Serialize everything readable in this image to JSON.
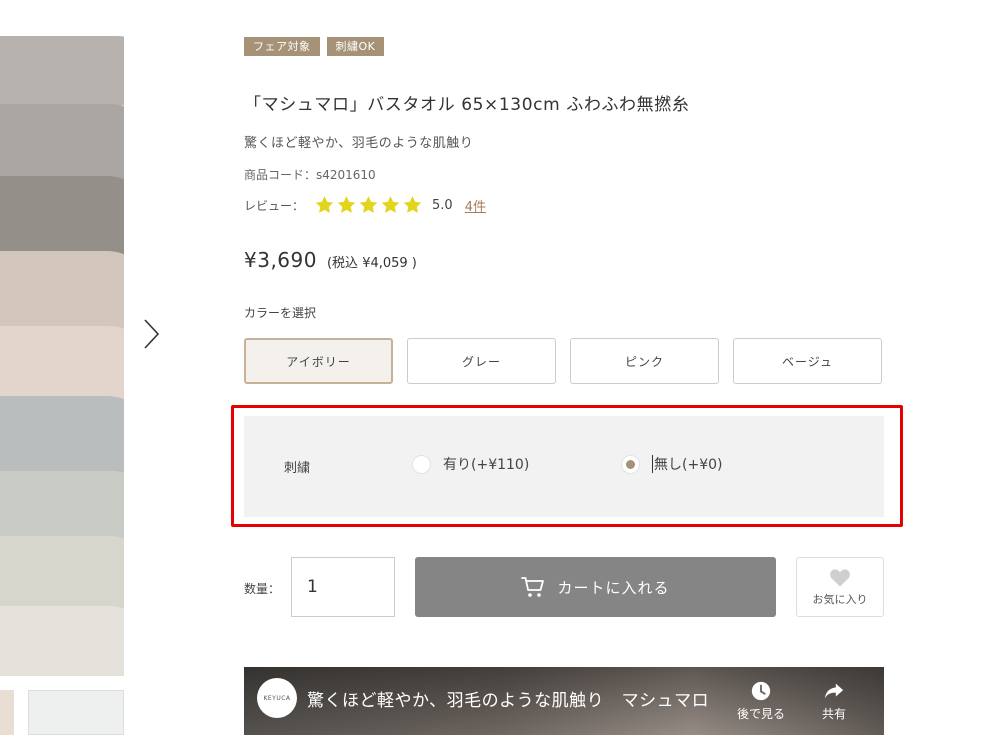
{
  "badges": [
    "フェア対象",
    "刺繍OK"
  ],
  "product": {
    "title": "「マシュマロ」バスタオル 65×130cm ふわふわ無撚糸",
    "subtitle": "驚くほど軽やか、羽毛のような肌触り",
    "code_label": "商品コード：s4201610"
  },
  "review": {
    "label": "レビュー：",
    "rating": 5,
    "score_text": "5.0",
    "count_text": "4件",
    "star_color": "#e3d41c"
  },
  "price": {
    "main": "¥3,690",
    "tax_included": "(税込 ¥4,059 )"
  },
  "color": {
    "label": "カラーを選択",
    "options": [
      "アイボリー",
      "グレー",
      "ピンク",
      "ベージュ"
    ],
    "selected": "アイボリー"
  },
  "embroidery": {
    "label": "刺繍",
    "option_yes": "有り(+¥110)",
    "option_no": "無し(+¥0)",
    "selected": "無し(+¥0)",
    "highlight_color": "#e60000"
  },
  "quantity": {
    "label": "数量：",
    "value": "1"
  },
  "cart": {
    "label": "カートに入れる",
    "icon": "cart-icon"
  },
  "favorite": {
    "label": "お気に入り",
    "icon": "heart-icon"
  },
  "video": {
    "channel_logo_text": "KEYUCA",
    "title": "驚くほど軽やか、羽毛のような肌触り　マシュマロ",
    "watch_later_label": "後で見る",
    "share_label": "共有"
  },
  "colors": {
    "accent_badge": "#a69377",
    "cart_button": "#858585",
    "link": "#a67b5b"
  }
}
